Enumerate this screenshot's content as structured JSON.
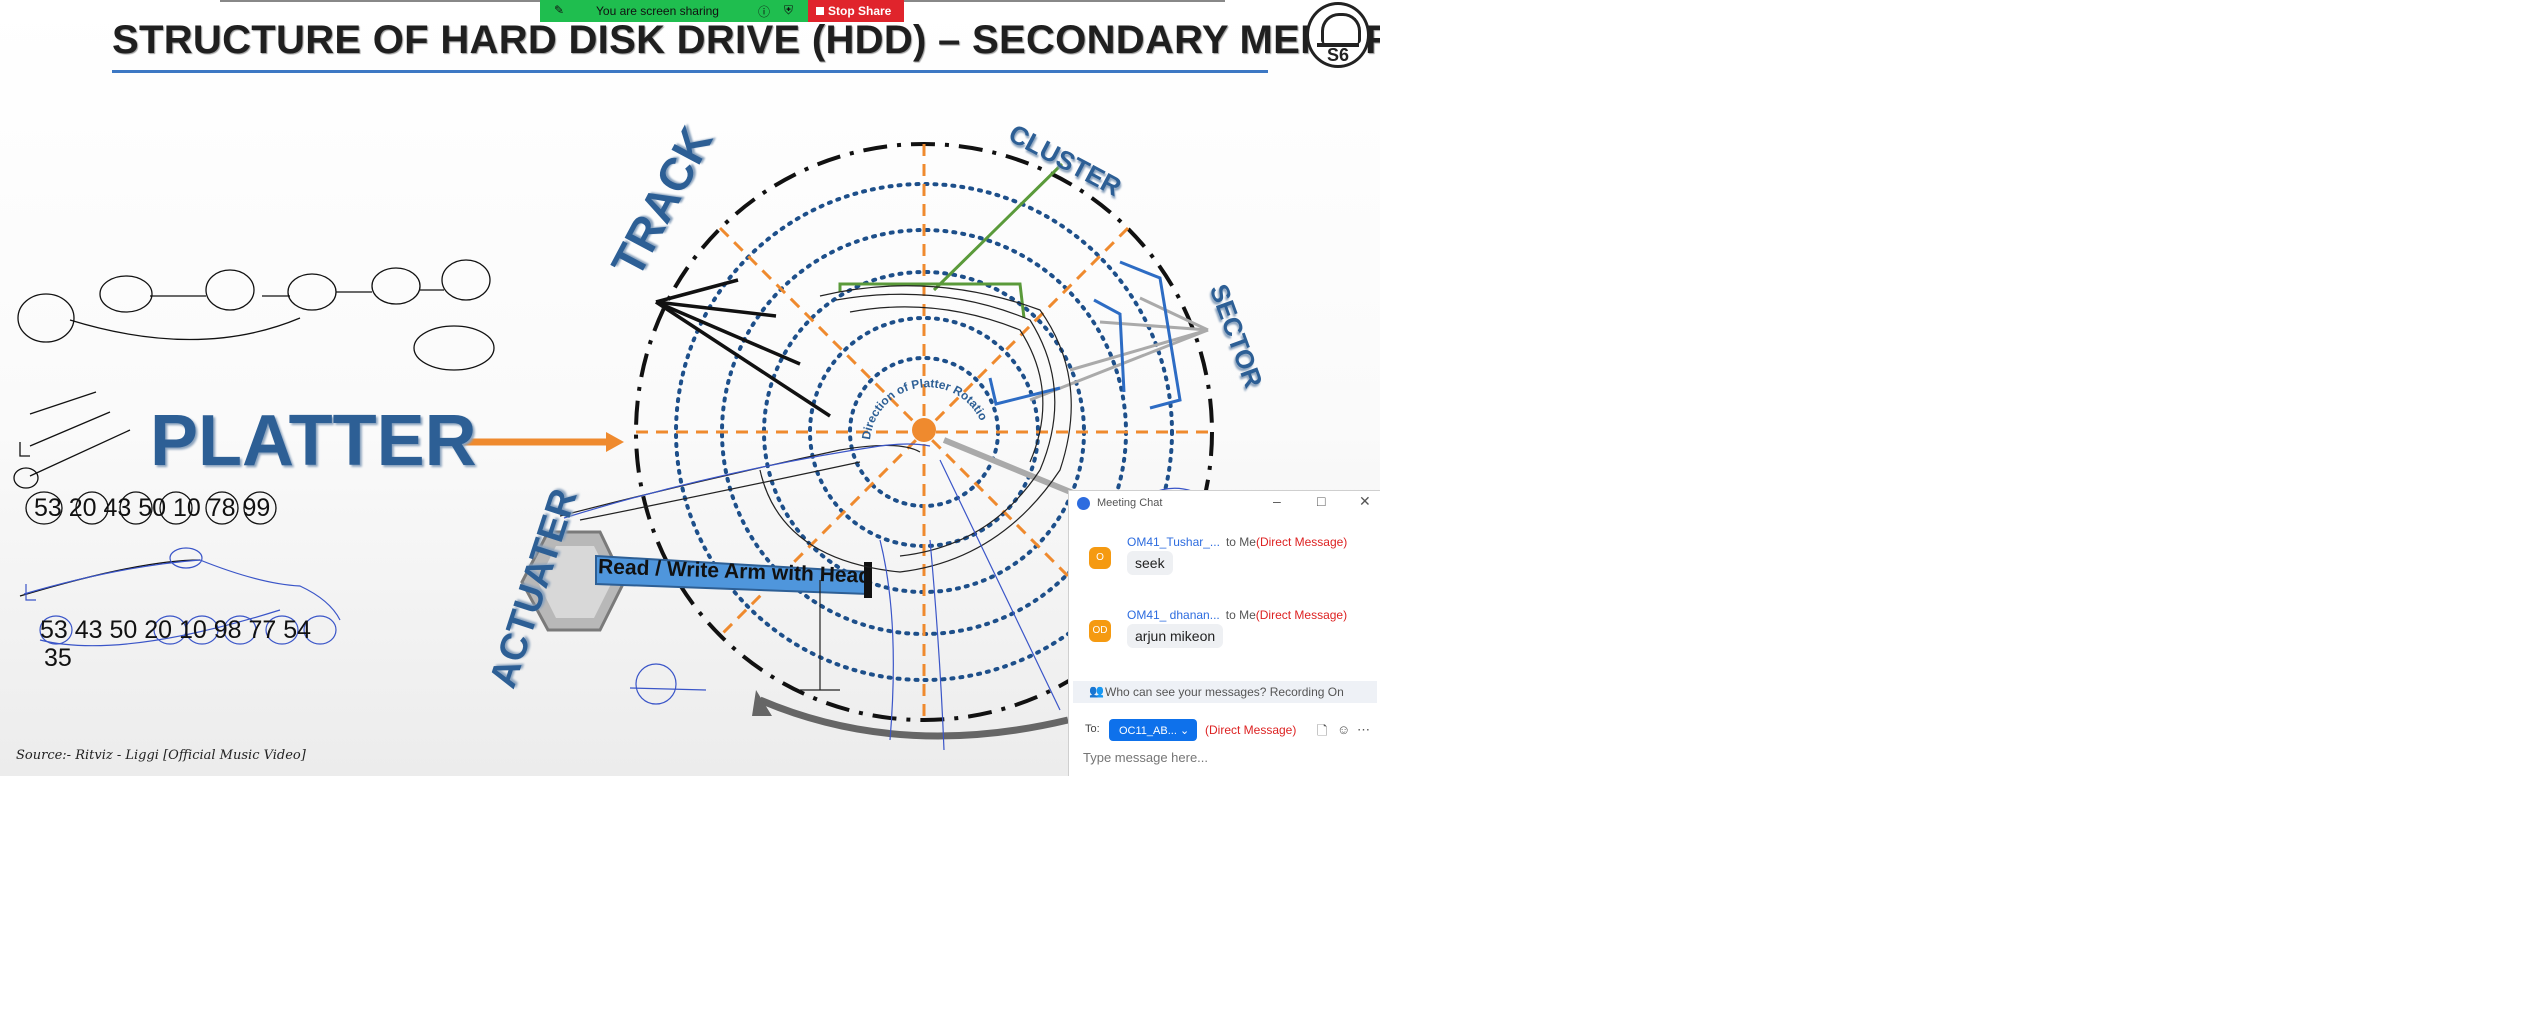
{
  "slide": {
    "title": "STRUCTURE OF HARD DISK DRIVE (HDD) – SECONDARY MEMORY",
    "logo_text": "S6",
    "labels": {
      "platter": "PLATTER",
      "track": "TRACK",
      "actuator": "ACTUATER",
      "cluster": "CLUSTER",
      "sector": "SECTOR",
      "arm": "Read / Write Arm with Head",
      "rotation": "Direction of Platter Rotation"
    },
    "source": "Source:- Ritviz - Liggi [Official Music Video]",
    "handwritten": {
      "row1": "53  20  43  50   10  78  99",
      "row2": "53  43 50   20  10   98   77  54",
      "row3": "35"
    }
  },
  "share_bar": {
    "text": "You are screen sharing",
    "stop_label": "Stop Share"
  },
  "chat": {
    "title": "Meeting Chat",
    "messages": [
      {
        "avatar": "O",
        "sender": "OM41_Tushar_...",
        "to": "to Me",
        "tag": "(Direct Message)",
        "text": "seek"
      },
      {
        "avatar": "OD",
        "sender": "OM41_ dhanan...",
        "to": "to Me",
        "tag": "(Direct Message)",
        "text": "arjun mikeon"
      }
    ],
    "notice": "Who can see your messages? Recording On",
    "to_label": "To:",
    "to_value": "OC11_AB...",
    "to_tag": "(Direct Message)",
    "input_placeholder": "Type message here..."
  },
  "colors": {
    "accent_blue": "#2d5f95",
    "orange_dash": "#ef8a2e",
    "track_dots": "#1d4f8a",
    "share_green": "#1fbe4f",
    "stop_red": "#e0242c",
    "chat_blue": "#0e71eb"
  },
  "icons": [
    "shield-icon",
    "info-icon",
    "minimize-icon",
    "maximize-icon",
    "close-icon",
    "file-icon",
    "emoji-icon",
    "more-icon",
    "chevron-down-icon",
    "people-icon"
  ]
}
